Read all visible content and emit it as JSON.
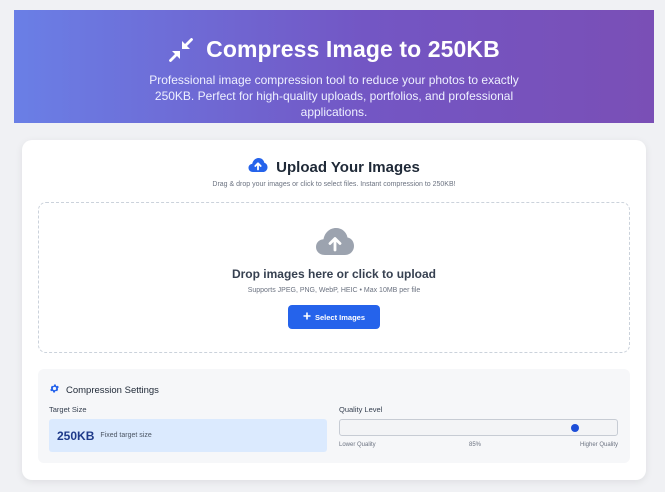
{
  "hero": {
    "title": "Compress Image to 250KB",
    "subtitle": "Professional image compression tool to reduce your photos to exactly 250KB. Perfect for high-quality uploads, portfolios, and professional applications.",
    "icon": "compress-arrows-icon"
  },
  "upload": {
    "heading": "Upload Your Images",
    "description": "Drag & drop your images or click to select files. Instant compression to 250KB!",
    "icon": "cloud-upload-icon"
  },
  "dropzone": {
    "title": "Drop images here or click to upload",
    "supported": "Supports JPEG, PNG, WebP, HEIC • Max 10MB per file",
    "button_label": "Select Images",
    "icon": "cloud-upload-icon"
  },
  "settings": {
    "heading": "Compression Settings",
    "icon": "gear-icon",
    "target_label": "Target Size",
    "target_value": "250KB",
    "target_note": "Fixed target size",
    "quality_label": "Quality Level",
    "quality_value": 0.85,
    "scale_low": "Lower Quality",
    "scale_mid": "85%",
    "scale_high": "Higher Quality"
  },
  "colors": {
    "accent": "#2563eb",
    "hero_start": "#6a7fe6",
    "hero_end": "#7a4fb6"
  }
}
